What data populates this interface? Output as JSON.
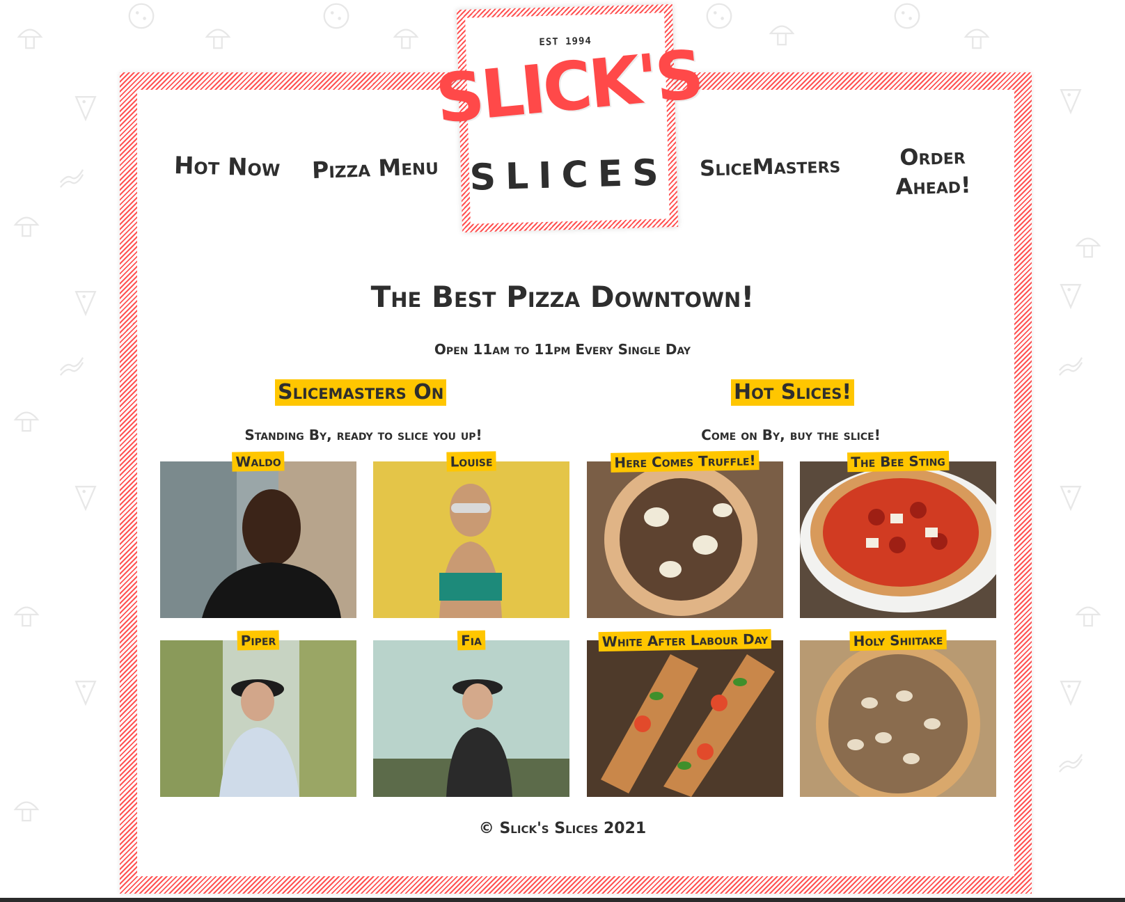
{
  "colors": {
    "accent_red": "#ff4949",
    "highlight_yellow": "#ffc600",
    "text_dark": "#2e2e2e",
    "stripe": "#ff5252"
  },
  "logo": {
    "est": "EST 1994",
    "name_top": "SLICK'S",
    "name_bottom": "SLICES"
  },
  "nav": {
    "hot_now": "Hot Now",
    "pizza_menu": "Pizza Menu",
    "slicemasters": "SliceMasters",
    "order_ahead": "Order Ahead!"
  },
  "main": {
    "headline": "The Best Pizza Downtown!",
    "hours": "Open 11am to 11pm Every Single Day"
  },
  "slicemasters": {
    "title": "Slicemasters On",
    "subtitle": "Standing By, ready to slice you up!",
    "people": [
      {
        "name": "Waldo"
      },
      {
        "name": "Louise"
      },
      {
        "name": "Piper"
      },
      {
        "name": "Fia"
      }
    ]
  },
  "hot_slices": {
    "title": "Hot Slices!",
    "subtitle": "Come on By, buy the slice!",
    "pizzas": [
      {
        "name": "Here Comes Truffle!"
      },
      {
        "name": "The Bee Sting"
      },
      {
        "name": "White After Labour Day"
      },
      {
        "name": "Holy Shiitake"
      }
    ]
  },
  "footer": {
    "text": "© Slick's Slices 2021"
  },
  "icons": [
    "pizza-icon",
    "mushroom-icon",
    "bacon-icon"
  ]
}
